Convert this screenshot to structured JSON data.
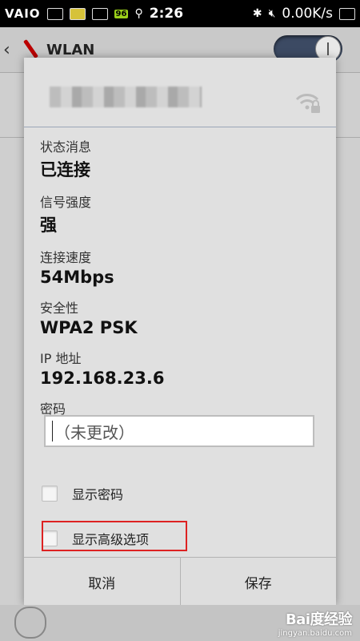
{
  "status_bar": {
    "brand": "VAIO",
    "battery_level": "96",
    "time": "2:26",
    "network_speed": "0.00K/s"
  },
  "app_bar": {
    "title": "WLAN",
    "wifi_enabled": true
  },
  "dialog": {
    "ssid_partial": "der",
    "ssid_status_partial": "已连接",
    "fields": [
      {
        "label": "状态消息",
        "value": "已连接"
      },
      {
        "label": "信号强度",
        "value": "强"
      },
      {
        "label": "连接速度",
        "value": "54Mbps"
      },
      {
        "label": "安全性",
        "value": "WPA2 PSK"
      },
      {
        "label": "IP 地址",
        "value": "192.168.23.6"
      }
    ],
    "password": {
      "label": "密码",
      "placeholder": "（未更改）"
    },
    "show_password_label": "显示密码",
    "show_advanced_label": "显示高级选项",
    "cancel_label": "取消",
    "save_label": "保存"
  },
  "watermark": {
    "logo": "Bai度经验",
    "url": "jingyan.baidu.com"
  },
  "colors": {
    "highlight_border": "#dd2222",
    "toggle_on": "#3c4a63"
  }
}
